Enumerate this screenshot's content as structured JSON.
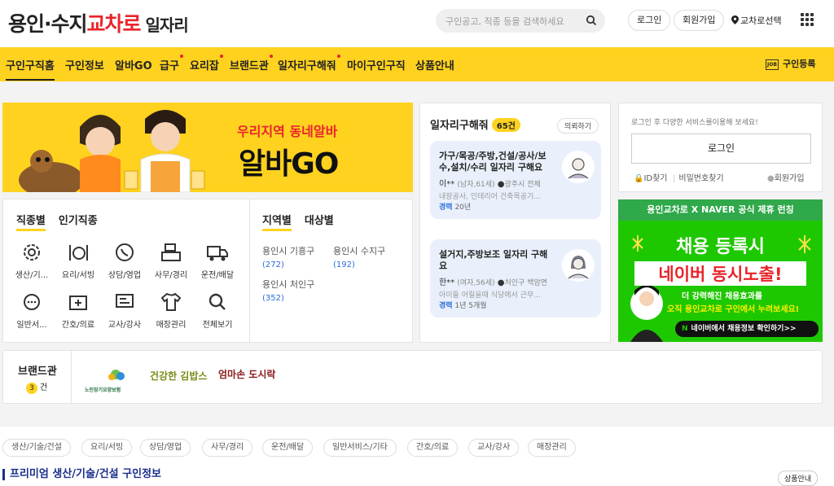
{
  "header": {
    "logo_main": "용인·수지",
    "logo_accent": "교차로",
    "logo_sub": "일자리",
    "search_placeholder": "구인공고, 직종 등을 검색하세요",
    "login": "로그인",
    "signup": "회원가입",
    "select_region": "교차로선택"
  },
  "nav": {
    "items": [
      "구인구직홈",
      "구인정보",
      "알바GO",
      "급구",
      "요리잡",
      "브랜드관",
      "일자리구해줘",
      "마이구인구직",
      "상품안내"
    ],
    "register": "구인등록"
  },
  "banner": {
    "line1": "우리지역 동네알바",
    "line2": "알바GO"
  },
  "categories": {
    "tabs": [
      "직종별",
      "인기직종"
    ],
    "items": [
      "생산/기...",
      "요리/서빙",
      "상담/영업",
      "사무/경리",
      "운전/배달",
      "일반서...",
      "간호/의료",
      "교사/강사",
      "매장관리",
      "전체보기"
    ]
  },
  "regions": {
    "tabs": [
      "지역별",
      "대상별"
    ],
    "items": [
      {
        "name": "용인시 기흥구",
        "count": "(272)"
      },
      {
        "name": "용인시 수지구",
        "count": "(192)"
      },
      {
        "name": "용인시 처인구",
        "count": "(352)"
      }
    ]
  },
  "job_request": {
    "title": "일자리구해줘",
    "count": "65건",
    "button": "의뢰하기",
    "cards": [
      {
        "title": "가구/목공/주방,건설/공사/보수,설치/수리 일자리 구해요",
        "name": "이**",
        "info": "(남자,61세)",
        "loc": "광주시 전체",
        "desc": "내장공사, 인테리어 건축목공기...",
        "exp_label": "경력",
        "exp": "20년"
      },
      {
        "title": "설거지,주방보조 일자리 구해요",
        "name": "한**",
        "info": "(여자,56세)",
        "loc": "처인구 백암면",
        "desc": "아이들 어릴을때 식당에서 근무...",
        "exp_label": "경력",
        "exp": "1년 5개월"
      }
    ]
  },
  "login_box": {
    "notice": "로그인 후 다양한 서비스를이용해 보세요!",
    "button": "로그인",
    "find_id": "ID찾기",
    "find_pw": "비밀번호찾기",
    "signup": "회원가입"
  },
  "naver_ad": {
    "top": "용인교차로 X NAVER 공식 제휴 런칭",
    "h1": "채용 등록시",
    "h2": "네이버 동시노출!",
    "s1": "더 강력해진 채용효과를",
    "s2": "오직 용인교차로 구인에서 누려보세요!",
    "cta_n": "N",
    "cta": "네이버에서 채용정보 확인하기>>"
  },
  "brand": {
    "label": "브랜드관",
    "count": "3",
    "count_unit": "건",
    "logos": [
      "노인장기요양보험",
      "건강한 김밥스",
      "엄마손 도시락"
    ]
  },
  "chips": [
    "생산/기술/건설",
    "요리/서빙",
    "상담/영업",
    "사무/경리",
    "운전/배달",
    "일반서비스/기타",
    "간호/의료",
    "교사/강사",
    "매장관리"
  ],
  "premium": {
    "title": "프리미엄 생산/기술/건설 구인정보",
    "button": "상품안내"
  }
}
